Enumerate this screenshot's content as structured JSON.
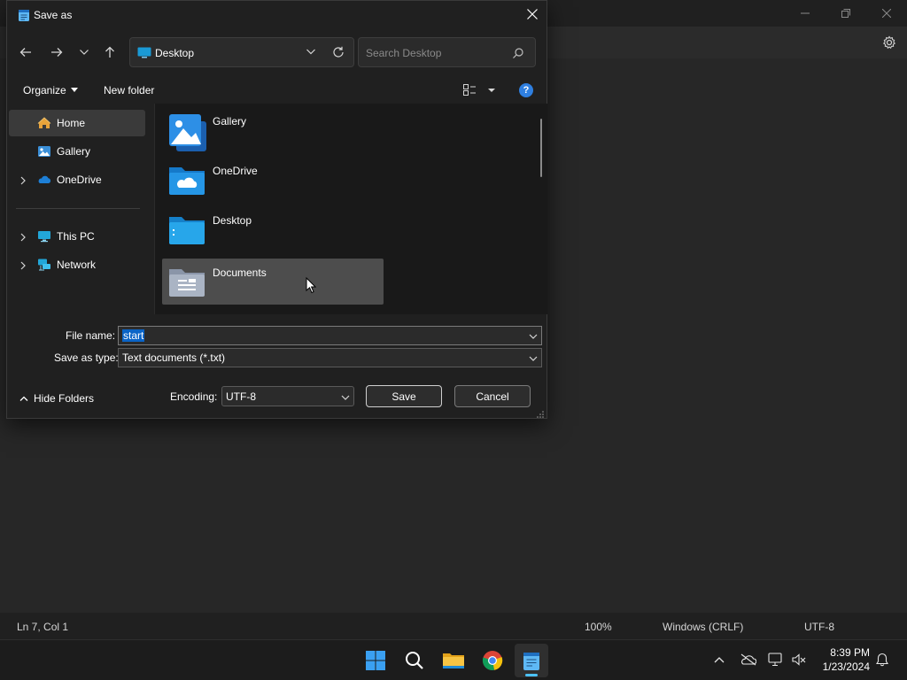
{
  "notepad": {
    "status": {
      "position": "Ln 7, Col 1",
      "zoom": "100%",
      "line_endings": "Windows (CRLF)",
      "encoding": "UTF-8"
    }
  },
  "dialog": {
    "title": "Save as",
    "address": "Desktop",
    "search_placeholder": "Search Desktop",
    "commands": {
      "organize": "Organize",
      "new_folder": "New folder",
      "help": "?"
    },
    "nav": [
      {
        "label": "Home",
        "icon": "home-icon",
        "selected": true
      },
      {
        "label": "Gallery",
        "icon": "gallery-icon"
      },
      {
        "label": "OneDrive",
        "icon": "onedrive-icon",
        "expandable": true
      },
      {
        "label": "This PC",
        "icon": "pc-icon",
        "expandable": true
      },
      {
        "label": "Network",
        "icon": "network-icon",
        "expandable": true
      }
    ],
    "files": [
      {
        "label": "Gallery",
        "icon": "gallery-folder-icon"
      },
      {
        "label": "OneDrive",
        "icon": "onedrive-folder-icon"
      },
      {
        "label": "Desktop",
        "icon": "desktop-folder-icon"
      },
      {
        "label": "Documents",
        "icon": "documents-folder-icon",
        "hover": true
      }
    ],
    "file_name_label": "File name:",
    "file_name_value": "start",
    "save_type_label": "Save as type:",
    "save_type_value": "Text documents (*.txt)",
    "hide_folders": "Hide Folders",
    "encoding_label": "Encoding:",
    "encoding_value": "UTF-8",
    "save_button": "Save",
    "cancel_button": "Cancel"
  },
  "taskbar": {
    "apps": [
      "start-icon",
      "search-icon",
      "file-explorer-icon",
      "chrome-icon",
      "notepad-icon"
    ],
    "time": "8:39 PM",
    "date": "1/23/2024"
  },
  "colors": {
    "accent": "#0a64c7",
    "taskbar_indicator": "#4cc2ff",
    "help": "#2f7fe0"
  }
}
